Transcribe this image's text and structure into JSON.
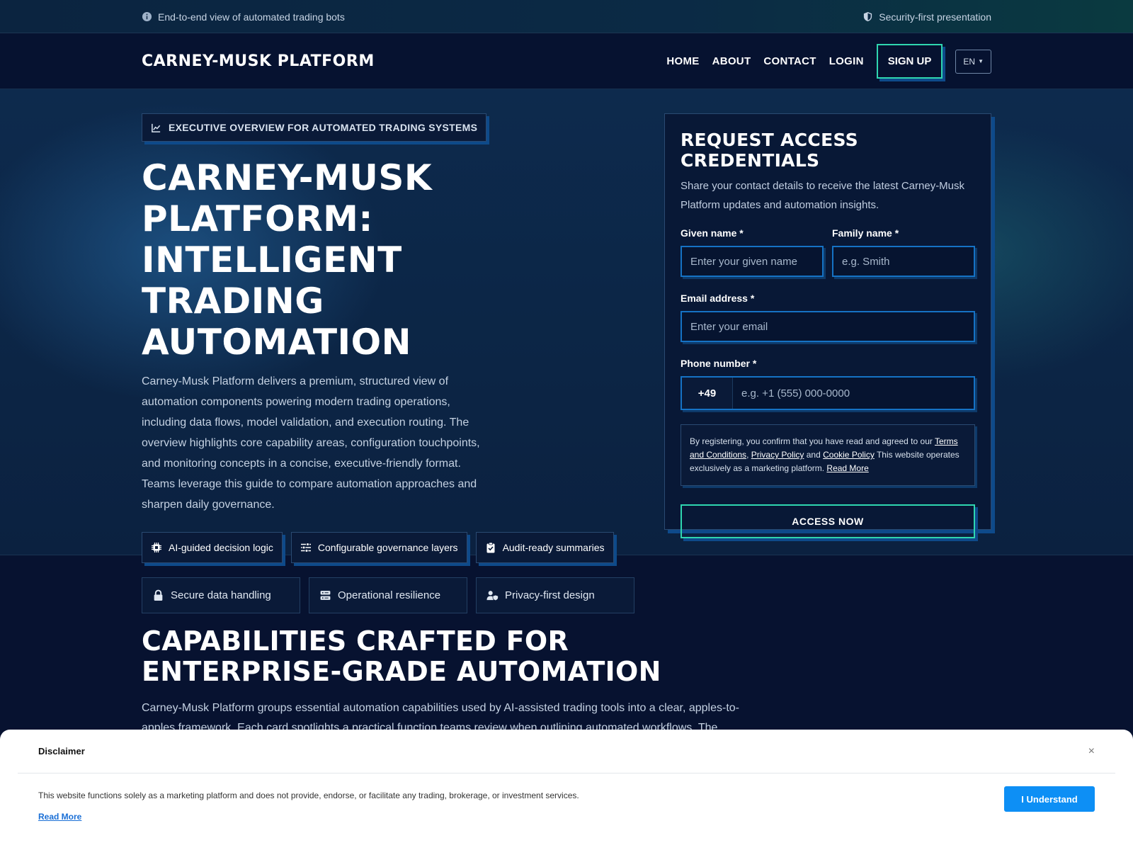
{
  "topbar": {
    "left_text": "End-to-end view of automated trading bots",
    "right_text": "Security-first presentation"
  },
  "header": {
    "brand": "CARNEY-MUSK PLATFORM",
    "nav": [
      "HOME",
      "ABOUT",
      "CONTACT",
      "LOGIN"
    ],
    "signup": "SIGN UP",
    "language": "EN"
  },
  "hero": {
    "eyebrow": "EXECUTIVE OVERVIEW FOR AUTOMATED TRADING SYSTEMS",
    "title": "CARNEY-MUSK PLATFORM: INTELLIGENT TRADING AUTOMATION",
    "lead": "Carney-Musk Platform delivers a premium, structured view of automation components powering modern trading operations, including data flows, model validation, and execution routing. The overview highlights core capability areas, configuration touchpoints, and monitoring concepts in a concise, executive-friendly format. Teams leverage this guide to compare automation approaches and sharpen daily governance.",
    "chips": [
      {
        "label": "AI-guided decision logic",
        "icon": "chip-icon"
      },
      {
        "label": "Configurable governance layers",
        "icon": "sliders-icon"
      },
      {
        "label": "Audit-ready summaries",
        "icon": "clipboard-check-icon"
      }
    ],
    "features": [
      {
        "label": "Secure data handling",
        "icon": "lock-icon"
      },
      {
        "label": "Operational resilience",
        "icon": "server-icon"
      },
      {
        "label": "Privacy-first design",
        "icon": "user-shield-icon"
      }
    ]
  },
  "form": {
    "title": "REQUEST ACCESS CREDENTIALS",
    "subtitle": "Share your contact details to receive the latest Carney-Musk Platform updates and automation insights.",
    "given_label": "Given name *",
    "given_placeholder": "Enter your given name",
    "family_label": "Family name *",
    "family_placeholder": "e.g. Smith",
    "email_label": "Email address *",
    "email_placeholder": "Enter your email",
    "phone_label": "Phone number *",
    "phone_code": "+49",
    "phone_placeholder": "e.g. +1 (555) 000-0000",
    "consent_pre": "By registering, you confirm that you have read and agreed to our ",
    "consent_terms": "Terms and Conditions",
    "consent_comma": ", ",
    "consent_privacy": "Privacy Policy",
    "consent_and": " and ",
    "consent_cookie": "Cookie Policy",
    "consent_post": " This website operates exclusively as a marketing platform. ",
    "consent_readmore": "Read More",
    "submit": "ACCESS NOW"
  },
  "capabilities": {
    "title": "CAPABILITIES CRAFTED FOR ENTERPRISE-GRADE AUTOMATION",
    "text": "Carney-Musk Platform groups essential automation capabilities used by AI-assisted trading tools into a clear, apples-to-apples framework. Each card spotlights a practical function teams review when outlining automated workflows. The descriptions emphasize"
  },
  "disclaimer": {
    "title": "Disclaimer",
    "close": "×",
    "text": "This website functions solely as a marketing platform and does not provide, endorse, or facilitate any trading, brokerage, or investment services.",
    "read_more": "Read More",
    "button": "I Understand"
  },
  "colors": {
    "accent_teal": "#2fd6b0",
    "accent_blue": "#1572c4",
    "button_blue": "#0d8ff5",
    "background": "#071230"
  }
}
